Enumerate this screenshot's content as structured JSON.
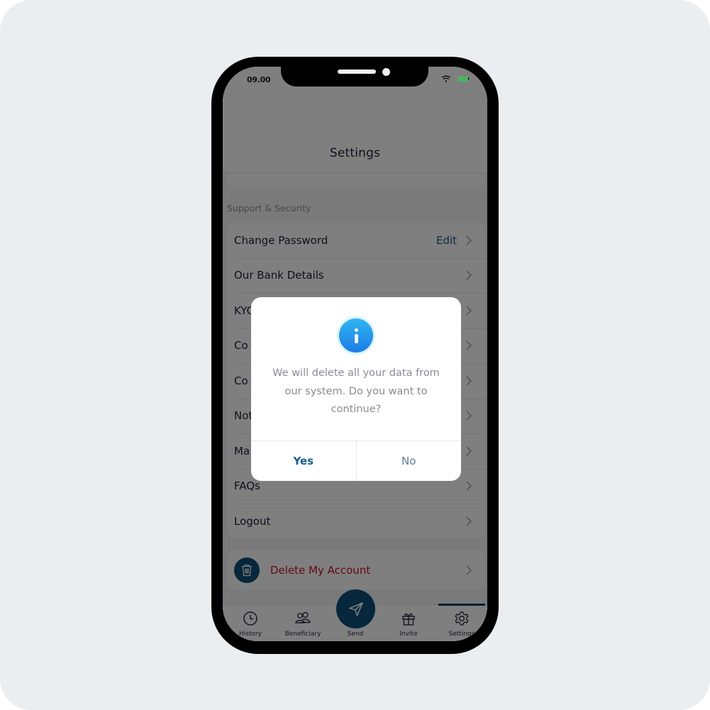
{
  "status_bar": {
    "time": "09.00",
    "icons": [
      "wifi-icon",
      "battery-icon"
    ],
    "battery_color": "#2ecc52"
  },
  "header": {
    "title": "Settings"
  },
  "section": {
    "label": "Support & Security"
  },
  "menu": {
    "items": [
      {
        "label": "Change Password",
        "action": "Edit"
      },
      {
        "label": "Our Bank Details",
        "action": ""
      },
      {
        "label": "KYC",
        "action": ""
      },
      {
        "label": "Co",
        "action": ""
      },
      {
        "label": "Co",
        "action": ""
      },
      {
        "label": "Not",
        "action": ""
      },
      {
        "label": "Ma",
        "action": ""
      },
      {
        "label": "FAQs",
        "action": ""
      },
      {
        "label": "Logout",
        "action": ""
      }
    ]
  },
  "delete_account": {
    "label": "Delete My Account",
    "color": "#c8102e",
    "icon": "trash-icon"
  },
  "tabbar": {
    "tabs": [
      {
        "label": "History",
        "icon": "clock-icon"
      },
      {
        "label": "Beneficiary",
        "icon": "users-icon"
      },
      {
        "label": "Send",
        "icon": "send-icon"
      },
      {
        "label": "Invite",
        "icon": "gift-icon"
      },
      {
        "label": "Settings",
        "icon": "gear-icon"
      }
    ],
    "active": "Settings",
    "accent": "#0d4f78"
  },
  "dialog": {
    "icon": "info-icon",
    "message": "We will delete all your data from our system. Do you want to continue?",
    "yes_label": "Yes",
    "no_label": "No"
  }
}
